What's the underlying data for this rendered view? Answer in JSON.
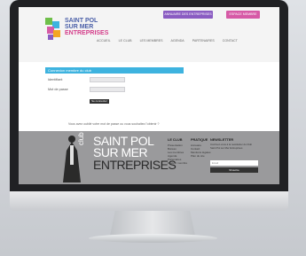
{
  "site": {
    "logo": {
      "line1": "SAINT POL",
      "line2": "SUR MER",
      "line3": "ENTREPRISES"
    },
    "top_buttons": [
      "ANNUAIRE DES ENTREPRISES",
      "ESPACE MEMBRE"
    ],
    "nav": [
      "ACCUEIL",
      "LE CLUB",
      "LES MEMBRES",
      "AGENDA",
      "PARTENAIRES",
      "CONTACT"
    ],
    "login": {
      "title": "Connexion membre du club",
      "login_label": "Identifiant",
      "password_label": "Mot de passe",
      "submit_label": "Se connecter",
      "forgot_text": "Vous avez oublié votre mot de passe ou vous souhaitez l'obtenir ?"
    },
    "footer": {
      "club": "club",
      "brand": {
        "line1": "SAINT POL",
        "line2": "SUR MER",
        "line3": "ENTREPRISES"
      },
      "col1_title": "LE CLUB",
      "col1_items": [
        "Présentation",
        "Bureau",
        "Les membres",
        "Agenda",
        "Partenaires",
        "Devenir membre"
      ],
      "col2_title": "PRATIQUE",
      "col2_items": [
        "Annuaire",
        "Contact",
        "Mentions légales",
        "Plan du site"
      ],
      "newsletter_title": "NEWSLETTER",
      "newsletter_text": "Inscrivez-vous à la newsletter du Club Saint Pol sur Mer Entreprises",
      "newsletter_placeholder": "Email",
      "newsletter_button": "S'inscrire"
    }
  },
  "colors": {
    "accent_blue": "#3eb3df",
    "accent_pink": "#d65aa6",
    "accent_purple": "#8a5cc2"
  }
}
